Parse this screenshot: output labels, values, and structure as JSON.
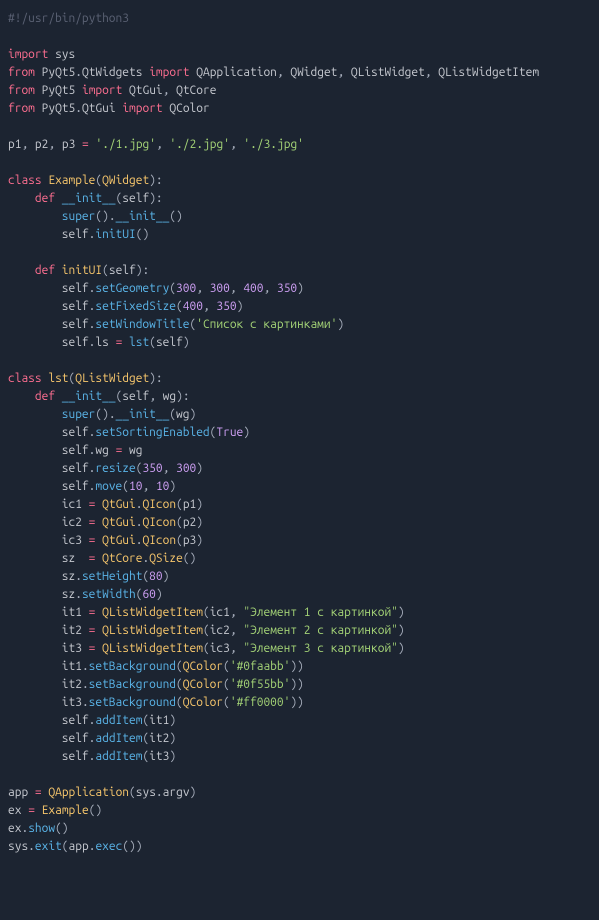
{
  "code": {
    "shebang": "#!/usr/bin/python3",
    "l3": {
      "s1": "import",
      "s2": "sys"
    },
    "l4": {
      "s1": "from",
      "s2": "PyQt5",
      "s3": "QtWidgets",
      "s4": "import",
      "s5": "QApplication",
      "s6": "QWidget",
      "s7": "QListWidget",
      "s8": "QListWidgetItem"
    },
    "l5": {
      "s1": "from",
      "s2": "PyQt5",
      "s3": "import",
      "s4": "QtGui",
      "s5": "QtCore"
    },
    "l6": {
      "s1": "from",
      "s2": "PyQt5",
      "s3": "QtGui",
      "s4": "import",
      "s5": "QColor"
    },
    "l8": {
      "s1": "p1",
      "s2": "p2",
      "s3": "p3",
      "v1": "'./1.jpg'",
      "v2": "'./2.jpg'",
      "v3": "'./3.jpg'"
    },
    "l10": {
      "s1": "class",
      "s2": "Example",
      "s3": "QWidget"
    },
    "l11": {
      "s1": "def",
      "s2": "__init__",
      "s3": "self"
    },
    "l12": {
      "s1": "super",
      "s2": "__init__"
    },
    "l13": {
      "s1": "self",
      "s2": "initUI"
    },
    "l15": {
      "s1": "def",
      "s2": "initUI",
      "s3": "self"
    },
    "l16": {
      "s1": "self",
      "s2": "setGeometry",
      "v1": "300",
      "v2": "300",
      "v3": "400",
      "v4": "350"
    },
    "l17": {
      "s1": "self",
      "s2": "setFixedSize",
      "v1": "400",
      "v2": "350"
    },
    "l18": {
      "s1": "self",
      "s2": "setWindowTitle",
      "v1": "'Список с картинками'"
    },
    "l19": {
      "s1": "self",
      "s2": "ls",
      "s3": "lst",
      "s4": "self"
    },
    "l21": {
      "s1": "class",
      "s2": "lst",
      "s3": "QListWidget"
    },
    "l22": {
      "s1": "def",
      "s2": "__init__",
      "s3": "self",
      "s4": "wg"
    },
    "l23": {
      "s1": "super",
      "s2": "__init__",
      "s3": "wg"
    },
    "l24": {
      "s1": "self",
      "s2": "setSortingEnabled",
      "v1": "True"
    },
    "l25": {
      "s1": "self",
      "s2": "wg",
      "s3": "wg"
    },
    "l26": {
      "s1": "self",
      "s2": "resize",
      "v1": "350",
      "v2": "300"
    },
    "l27": {
      "s1": "self",
      "s2": "move",
      "v1": "10",
      "v2": "10"
    },
    "l28": {
      "s1": "ic1",
      "s2": "QtGui",
      "s3": "QIcon",
      "s4": "p1"
    },
    "l29": {
      "s1": "ic2",
      "s2": "QtGui",
      "s3": "QIcon",
      "s4": "p2"
    },
    "l30": {
      "s1": "ic3",
      "s2": "QtGui",
      "s3": "QIcon",
      "s4": "p3"
    },
    "l31": {
      "s1": "sz",
      "s2": "QtCore",
      "s3": "QSize"
    },
    "l32": {
      "s1": "sz",
      "s2": "setHeight",
      "v1": "80"
    },
    "l33": {
      "s1": "sz",
      "s2": "setWidth",
      "v1": "60"
    },
    "l34": {
      "s1": "it1",
      "s2": "QListWidgetItem",
      "s3": "ic1",
      "v1": "\"Элемент 1 с картинкой\""
    },
    "l35": {
      "s1": "it2",
      "s2": "QListWidgetItem",
      "s3": "ic2",
      "v1": "\"Элемент 2 с картинкой\""
    },
    "l36": {
      "s1": "it3",
      "s2": "QListWidgetItem",
      "s3": "ic3",
      "v1": "\"Элемент 3 с картинкой\""
    },
    "l37": {
      "s1": "it1",
      "s2": "setBackground",
      "s3": "QColor",
      "v1": "'#0faabb'"
    },
    "l38": {
      "s1": "it2",
      "s2": "setBackground",
      "s3": "QColor",
      "v1": "'#0f55bb'"
    },
    "l39": {
      "s1": "it3",
      "s2": "setBackground",
      "s3": "QColor",
      "v1": "'#ff0000'"
    },
    "l40": {
      "s1": "self",
      "s2": "addItem",
      "s3": "it1"
    },
    "l41": {
      "s1": "self",
      "s2": "addItem",
      "s3": "it2"
    },
    "l42": {
      "s1": "self",
      "s2": "addItem",
      "s3": "it3"
    },
    "l44": {
      "s1": "app",
      "s2": "QApplication",
      "s3": "sys",
      "s4": "argv"
    },
    "l45": {
      "s1": "ex",
      "s2": "Example"
    },
    "l46": {
      "s1": "ex",
      "s2": "show"
    },
    "l47": {
      "s1": "sys",
      "s2": "exit",
      "s3": "app",
      "s4": "exec"
    }
  }
}
